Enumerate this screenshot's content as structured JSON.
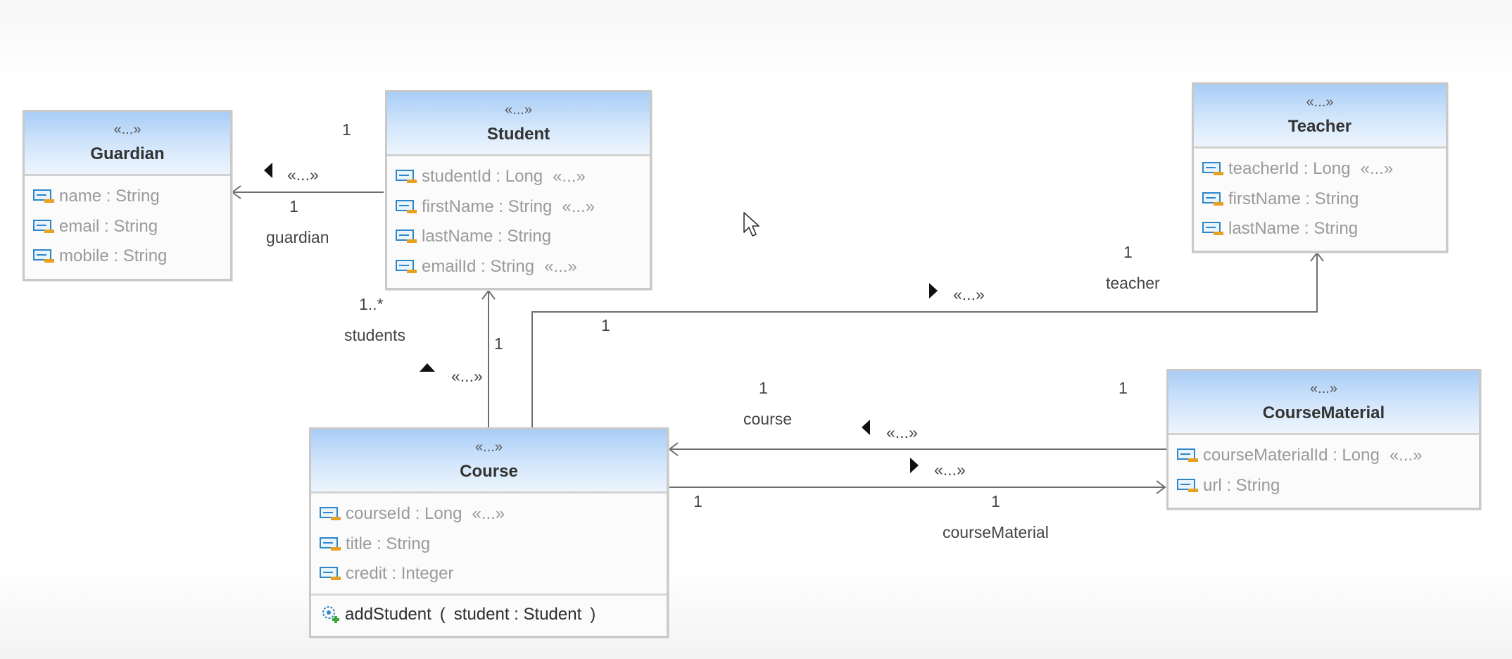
{
  "classes": {
    "guardian": {
      "stereotype": "«...»",
      "name": "Guardian",
      "attributes": [
        {
          "text": "name : String",
          "tag": ""
        },
        {
          "text": "email : String",
          "tag": ""
        },
        {
          "text": "mobile : String",
          "tag": ""
        }
      ]
    },
    "student": {
      "stereotype": "«...»",
      "name": "Student",
      "attributes": [
        {
          "text": "studentId : Long",
          "tag": "«...»"
        },
        {
          "text": "firstName : String",
          "tag": "«...»"
        },
        {
          "text": "lastName : String",
          "tag": ""
        },
        {
          "text": "emailId : String",
          "tag": "«...»"
        }
      ]
    },
    "teacher": {
      "stereotype": "«...»",
      "name": "Teacher",
      "attributes": [
        {
          "text": "teacherId : Long",
          "tag": "«...»"
        },
        {
          "text": "firstName : String",
          "tag": ""
        },
        {
          "text": "lastName : String",
          "tag": ""
        }
      ]
    },
    "course": {
      "stereotype": "«...»",
      "name": "Course",
      "attributes": [
        {
          "text": "courseId : Long",
          "tag": "«...»"
        },
        {
          "text": "title : String",
          "tag": ""
        },
        {
          "text": "credit : Integer",
          "tag": ""
        }
      ],
      "operations": [
        {
          "name": "addStudent",
          "open": "(",
          "params": "student : Student",
          "close": ")"
        }
      ]
    },
    "courseMaterial": {
      "stereotype": "«...»",
      "name": "CourseMaterial",
      "attributes": [
        {
          "text": "courseMaterialId : Long",
          "tag": "«...»"
        },
        {
          "text": "url : String",
          "tag": ""
        }
      ]
    }
  },
  "associations": {
    "student_guardian": {
      "source_mult": "1",
      "target_mult": "1",
      "stereotype": "«...»",
      "role": "guardian"
    },
    "course_student": {
      "source_mult": "1",
      "target_mult": "1..*",
      "stereotype": "«...»",
      "role": "students"
    },
    "course_teacher": {
      "source_mult": "1",
      "target_mult": "1",
      "stereotype": "«...»",
      "role": "teacher"
    },
    "material_course": {
      "source_mult": "1",
      "target_mult": "1",
      "stereotype": "«...»",
      "role": "course"
    },
    "course_material": {
      "source_mult": "1",
      "target_mult": "1",
      "stereotype": "«...»",
      "role": "courseMaterial"
    }
  }
}
